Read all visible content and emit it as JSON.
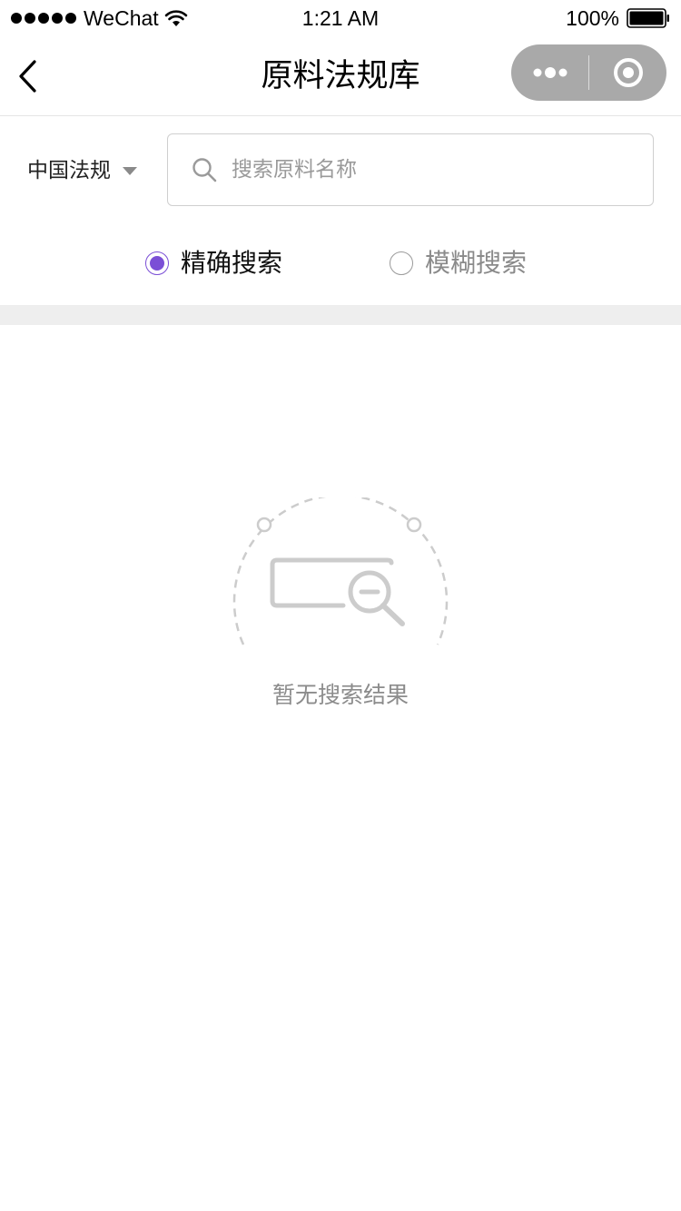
{
  "status_bar": {
    "carrier": "WeChat",
    "time": "1:21 AM",
    "battery": "100%",
    "icons": [
      "signal-dots-icon",
      "wifi-icon",
      "battery-icon"
    ]
  },
  "nav": {
    "title": "原料法规库",
    "back_icon": "chevron-left-icon",
    "capsule_icons": [
      "more-dots-icon",
      "close-circle-icon"
    ]
  },
  "search": {
    "region": "中国法规",
    "region_icon": "caret-down-icon",
    "placeholder": "搜索原料名称",
    "value": "",
    "search_icon": "search-icon"
  },
  "search_mode": {
    "options": [
      {
        "label": "精确搜索",
        "checked": true
      },
      {
        "label": "模糊搜索",
        "checked": false
      }
    ]
  },
  "empty_state": {
    "icon": "no-results-magnifier-icon",
    "message": "暂无搜索结果"
  },
  "colors": {
    "accent": "#7b4fd6",
    "capsule": "#a9a9a9",
    "divider_band": "#eeeeee",
    "muted_text": "#8c8c8c"
  }
}
